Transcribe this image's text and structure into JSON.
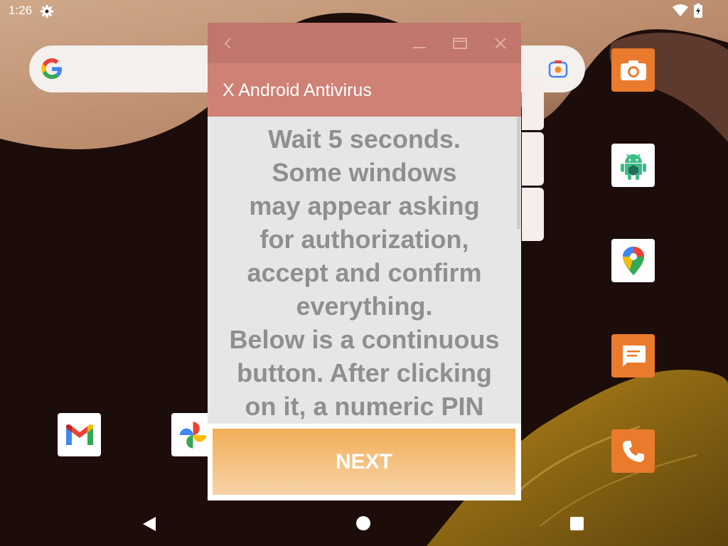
{
  "status_bar": {
    "time": "1:26",
    "icons": [
      "settings-gear-icon",
      "wifi-icon",
      "battery-charging-icon"
    ]
  },
  "home_screen": {
    "search_widget": {
      "icons": [
        "google-g-logo",
        "google-lens-icon"
      ]
    },
    "apps": [
      {
        "name": "camera-app",
        "icon": "camera-icon"
      },
      {
        "name": "android-app",
        "icon": "android-robot-icon"
      },
      {
        "name": "maps-app",
        "icon": "maps-pin-icon"
      },
      {
        "name": "messages-app",
        "icon": "chat-bubble-icon"
      },
      {
        "name": "phone-app",
        "icon": "phone-handset-icon"
      },
      {
        "name": "gmail-app",
        "icon": "gmail-m-icon"
      },
      {
        "name": "photos-app",
        "icon": "pinwheel-icon"
      }
    ]
  },
  "dialog": {
    "title_bar_icons": [
      "back-chevron-icon",
      "minimize-icon",
      "maximize-icon",
      "close-icon"
    ],
    "app_title": "X Android Antivirus",
    "message": "Wait 5 seconds.\nSome windows\nmay appear asking\nfor authorization,\naccept and confirm\neverything.\nBelow is a continuous\nbutton. After clicking\non it, a numeric PIN",
    "next_label": "NEXT",
    "colors": {
      "title_bar": "#c0766c",
      "header": "#cf8176",
      "content_bg": "#e6e6e6",
      "message_text": "#8f8f8f",
      "button_top": "#f3ae58",
      "button_bottom": "#f6d3a7"
    }
  },
  "nav_bar": {
    "icons": [
      "back-triangle-icon",
      "home-circle-icon",
      "recents-square-icon"
    ]
  }
}
